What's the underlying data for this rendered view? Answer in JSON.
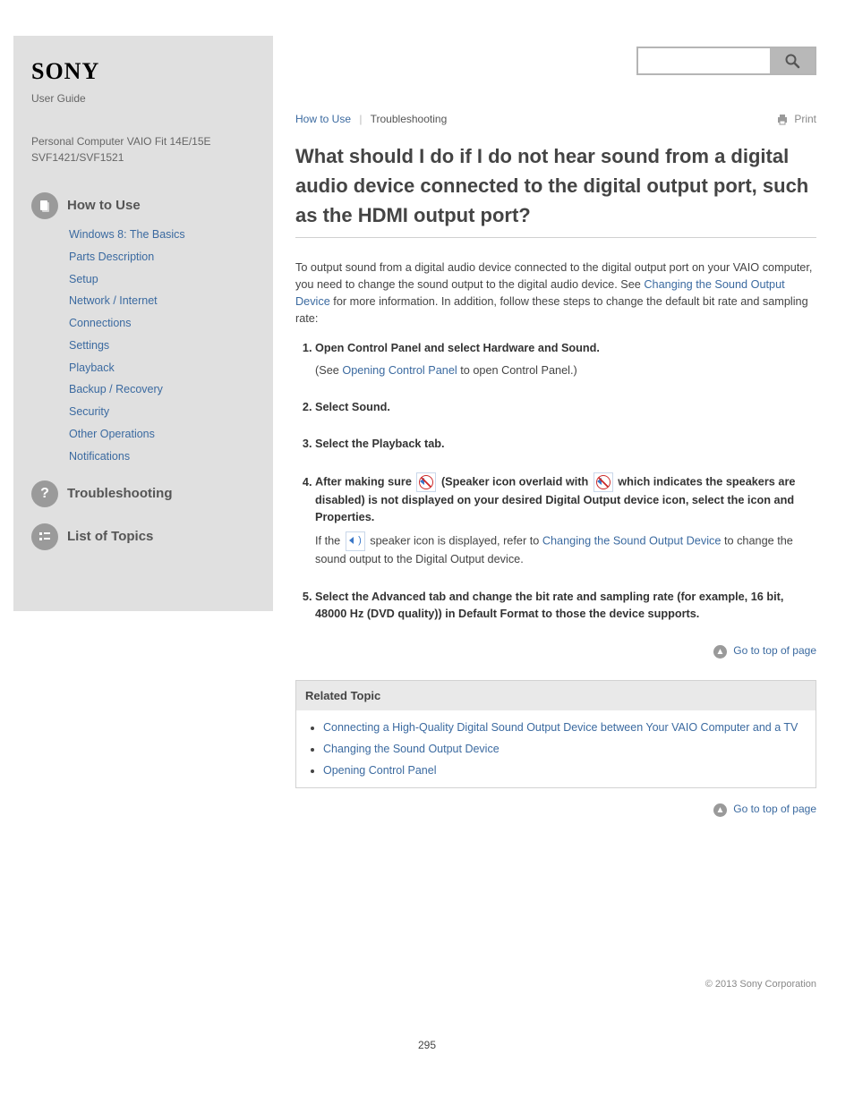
{
  "logo": {
    "brand": "SONY",
    "sub": "User Guide"
  },
  "model_line": "Personal Computer VAIO Fit 14E/15E SVF1421/SVF1521",
  "sidebar": {
    "howto_head": "How to Use",
    "howto_items": [
      "Windows 8: The Basics",
      "Parts Description",
      "Setup",
      "Network / Internet",
      "Connections",
      "Settings",
      "Playback",
      "Backup / Recovery",
      "Security",
      "Other Operations",
      "Notifications"
    ],
    "trouble_head": "Troubleshooting",
    "list_head": "List of Topics"
  },
  "search": {
    "placeholder": ""
  },
  "topbar": {
    "how_to_use": "How to Use",
    "breadcrumb": "Troubleshooting",
    "print": "Print"
  },
  "title": "What should I do if I do not hear sound from a digital audio device connected to the digital output port, such as the HDMI output port?",
  "intro": "To output sound from a digital audio device connected to the digital output port on your VAIO computer, you need to change the sound output to the digital audio device. See Changing the Sound Output Device for more information. In addition, follow these steps to change the default bit rate and sampling rate:",
  "intro_link": "Changing the Sound Output Device",
  "steps": [
    {
      "main": "Open Control Panel and select Hardware and Sound.",
      "link": "Control Panel",
      "sub": " (See Opening Control Panel to open Control Panel.)",
      "sublink": "Opening Control Panel"
    },
    {
      "main": "Select Sound."
    },
    {
      "main": "Select the Playback tab."
    },
    {
      "main": "After making sure ",
      "mid": " (Speaker icon overlaid with ",
      "mid2": " which indicates the speakers are disabled) is not displayed on your desired Digital Output device icon, select the icon and Properties.",
      "sub": "If the ",
      "sub2": " speaker icon is displayed, refer to Changing the Sound Output Device to change the sound output to the Digital Output device.",
      "sublink": "Changing the Sound Output Device"
    },
    {
      "main": "Select the Advanced tab and change the bit rate and sampling rate (for example, 16 bit, 48000 Hz (DVD quality)) in Default Format to those the device supports."
    }
  ],
  "goto_top": "Go to top of page",
  "related": {
    "head": "Related Topic",
    "items": [
      "Connecting a High-Quality Digital Sound Output Device between Your VAIO Computer and a TV",
      "Changing the Sound Output Device",
      "Opening Control Panel"
    ]
  },
  "footer": "© 2013 Sony Corporation",
  "page_number": "295"
}
